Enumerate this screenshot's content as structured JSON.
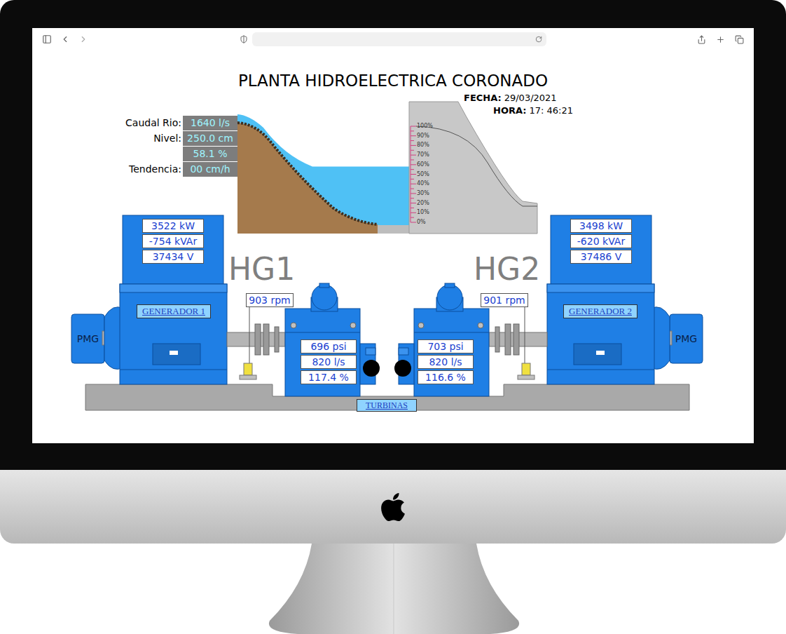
{
  "title": "PLANTA HIDROELECTRICA CORONADO",
  "date": {
    "label": "FECHA:",
    "value": "29/03/2021"
  },
  "time": {
    "label": "HORA:",
    "value": "17: 46:21"
  },
  "river": [
    {
      "label": "Caudal Rio:",
      "value": "1640 l/s"
    },
    {
      "label": "Nivel:",
      "value": "250.0 cm"
    },
    {
      "label": "",
      "value": "58.1 %"
    },
    {
      "label": "Tendencia:",
      "value": "00 cm/h"
    }
  ],
  "reservoir": {
    "level": 0.581,
    "scale": [
      "100%",
      "90%",
      "80%",
      "70%",
      "60%",
      "50%",
      "40%",
      "30%",
      "20%",
      "10%",
      "0%"
    ]
  },
  "units": [
    {
      "name": "HG1",
      "generator_label": "GENERADOR 1",
      "pmg": "PMG",
      "power": "3522 kW",
      "reactive": "-754 kVAr",
      "voltage": "37434 V",
      "speed": "903 rpm",
      "pressure": "696 psi",
      "flow": "820 l/s",
      "opening": "117.4 %"
    },
    {
      "name": "HG2",
      "generator_label": "GENERADOR 2",
      "pmg": "PMG",
      "power": "3498 kW",
      "reactive": "-620 kVAr",
      "voltage": "37486 V",
      "speed": "901 rpm",
      "pressure": "703 psi",
      "flow": "820 l/s",
      "opening": "116.6 %"
    }
  ],
  "turbines_label": "TURBINAS"
}
